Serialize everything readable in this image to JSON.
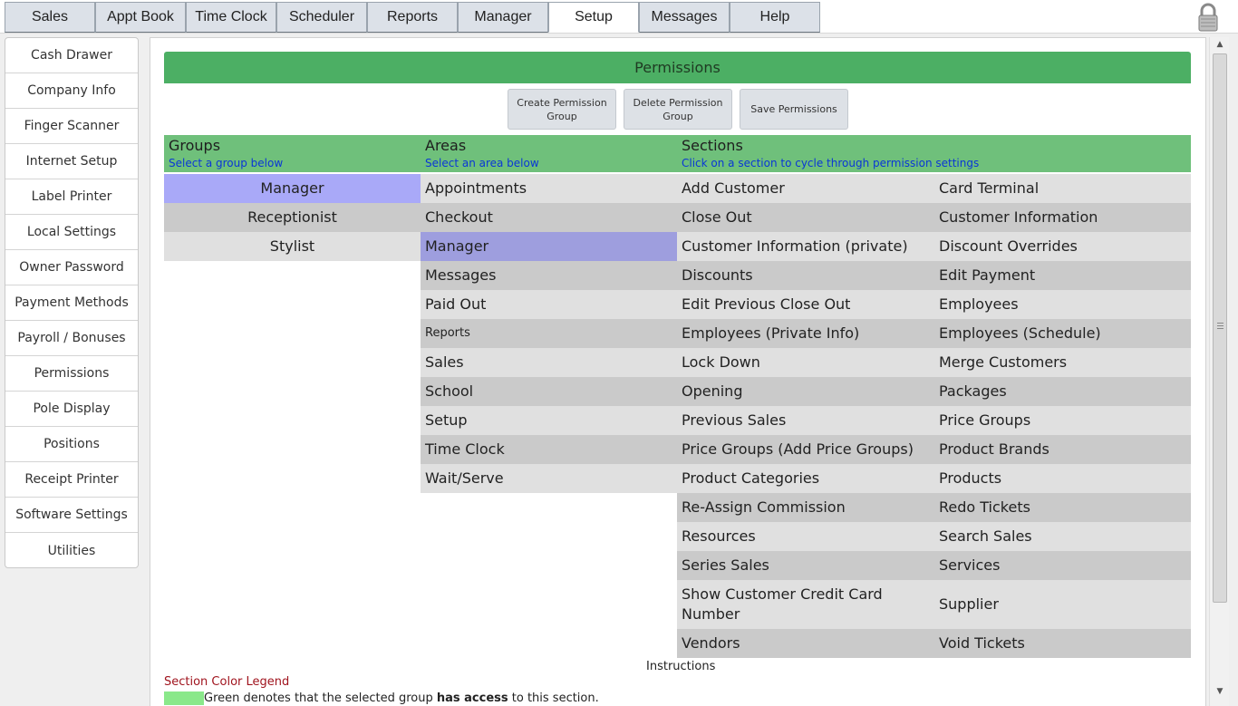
{
  "top_tabs": [
    {
      "label": "Sales"
    },
    {
      "label": "Appt Book"
    },
    {
      "label": "Time Clock"
    },
    {
      "label": "Scheduler"
    },
    {
      "label": "Reports"
    },
    {
      "label": "Manager"
    },
    {
      "label": "Setup",
      "active": true
    },
    {
      "label": "Messages"
    },
    {
      "label": "Help"
    }
  ],
  "sidebar": {
    "items": [
      "Cash Drawer",
      "Company Info",
      "Finger Scanner",
      "Internet Setup",
      "Label Printer",
      "Local Settings",
      "Owner Password",
      "Payment Methods",
      "Payroll / Bonuses",
      "Permissions",
      "Pole Display",
      "Positions",
      "Receipt Printer",
      "Software Settings",
      "Utilities"
    ]
  },
  "permissions": {
    "title": "Permissions",
    "buttons": {
      "create": "Create Permission Group",
      "delete": "Delete Permission Group",
      "save": "Save Permissions"
    },
    "columns": {
      "groups": {
        "title": "Groups",
        "subtitle": "Select a group below"
      },
      "areas": {
        "title": "Areas",
        "subtitle": "Select an area below"
      },
      "sections": {
        "title": "Sections",
        "subtitle": "Click on a section to cycle through permission settings"
      }
    },
    "groups": [
      "Manager",
      "Receptionist",
      "Stylist"
    ],
    "selected_group": "Manager",
    "areas": [
      "Appointments",
      "Checkout",
      "Manager",
      "Messages",
      "Paid Out",
      "Reports",
      "Sales",
      "School",
      "Setup",
      "Time Clock",
      "Wait/Serve"
    ],
    "selected_area": "Manager",
    "sections_left": [
      "Add Customer",
      "Close Out",
      "Customer Information (private)",
      "Discounts",
      "Edit Previous Close Out",
      "Employees (Private Info)",
      "Lock Down",
      "Opening",
      "Previous Sales",
      "Price Groups (Add Price Groups)",
      "Product Categories",
      "Re-Assign Commission",
      "Resources",
      "Series Sales",
      "Show Customer Credit Card Number",
      "Vendors"
    ],
    "sections_right": [
      "Card Terminal",
      "Customer Information",
      "Discount Overrides",
      "Edit Payment",
      "Employees",
      "Employees (Schedule)",
      "Merge Customers",
      "Packages",
      "Price Groups",
      "Product Brands",
      "Products",
      "Redo Tickets",
      "Search Sales",
      "Services",
      "Supplier",
      "Void Tickets"
    ],
    "instructions_label": "Instructions",
    "legend": {
      "title": "Section Color Legend",
      "green_before": "Green denotes that the selected group ",
      "green_bold": "has access",
      "green_after": " to this section."
    }
  },
  "colors": {
    "header_green": "#4caf64",
    "column_head_green": "#6fc07b",
    "selected_group": "#a9a9f8",
    "selected_area": "#9e9ede",
    "row_light": "#e0e0e0",
    "row_dark": "#cacaca",
    "legend_green": "#8ae88a",
    "subtitle_blue": "#0a36d6",
    "legend_title_red": "#a0141e"
  }
}
